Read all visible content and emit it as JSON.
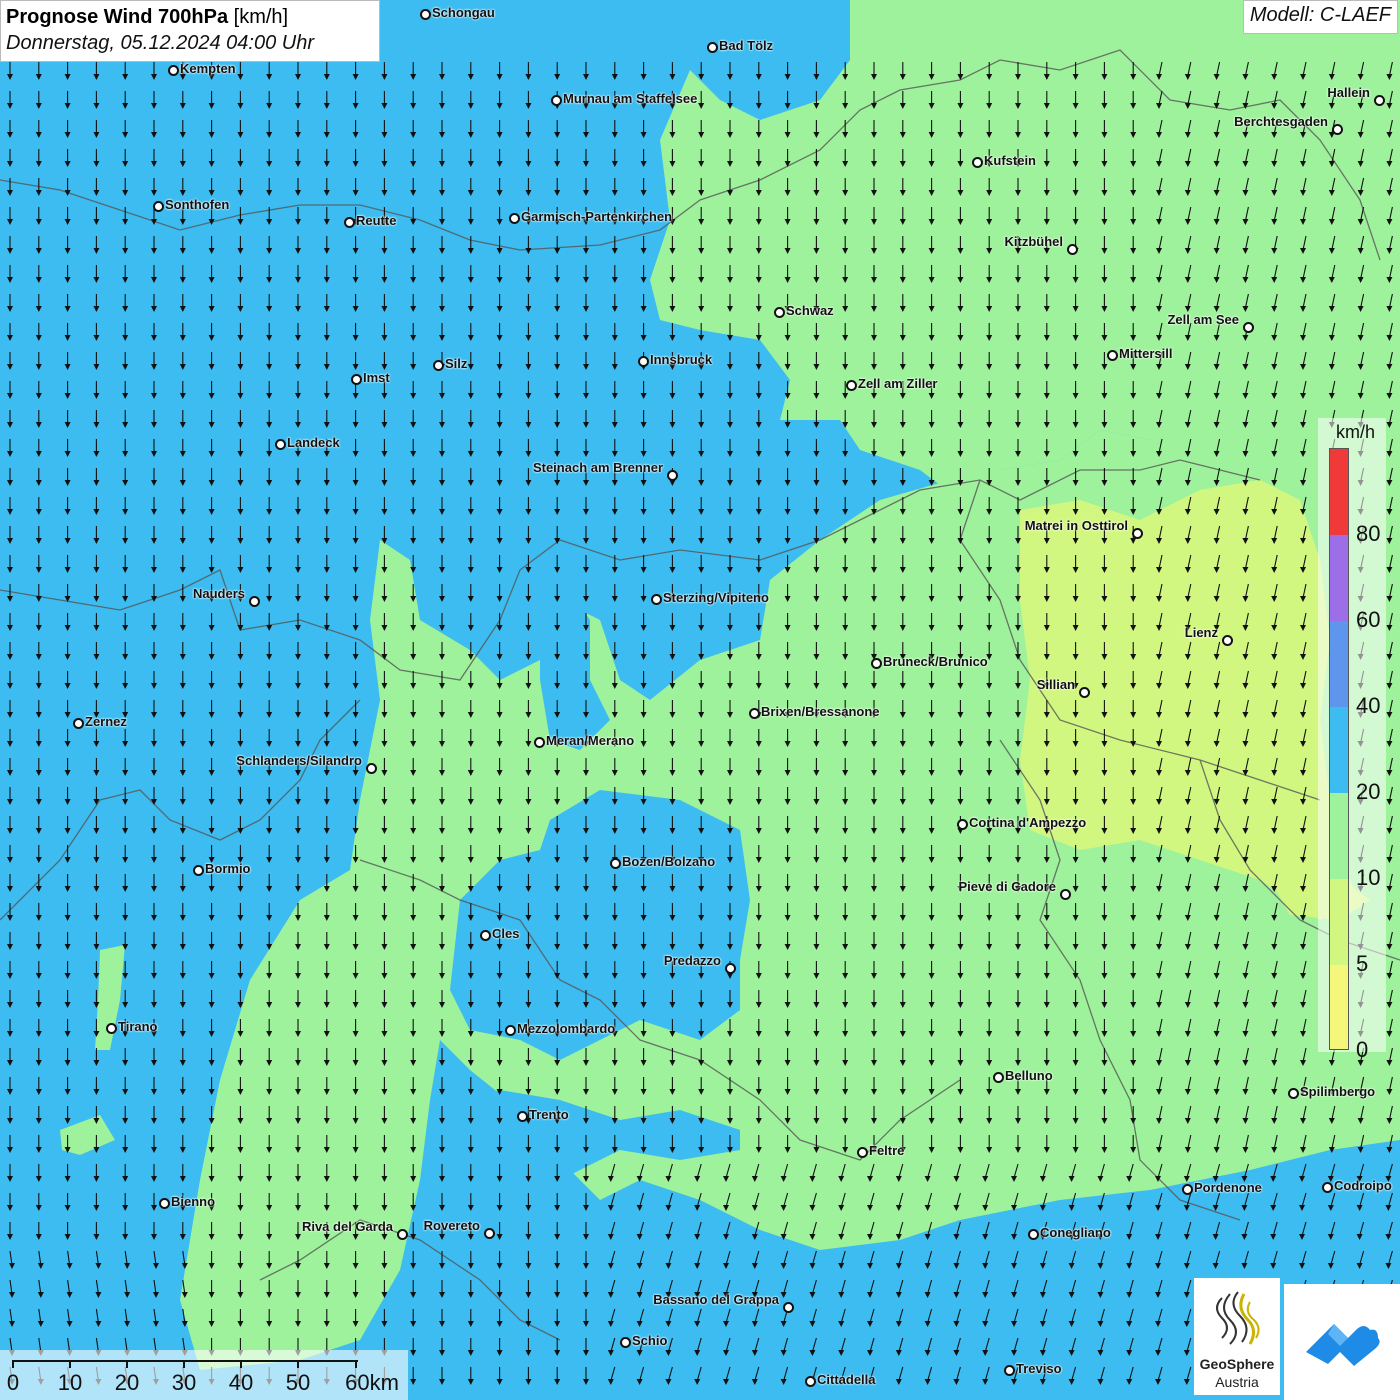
{
  "title": {
    "main": "Prognose Wind 700hPa",
    "unit": "[km/h]",
    "subtitle": "Donnerstag, 05.12.2024 04:00 Uhr"
  },
  "model_label": "Modell: C-LAEF",
  "colors": {
    "wind_0_5": "#f5f77a",
    "wind_5_10": "#d2f781",
    "wind_10_20": "#9ef29b",
    "wind_20_40": "#3cbcf0",
    "wind_40_60": "#5e96ee",
    "wind_60_80": "#9c6ee8",
    "wind_80_plus": "#f03a3a",
    "arrow": "#111111",
    "border": "#555555"
  },
  "legend": {
    "unit": "km/h",
    "ticks": [
      "80",
      "60",
      "40",
      "20",
      "10",
      "5",
      "0"
    ]
  },
  "wind_field": {
    "predominant_direction": "from north (arrows pointing south)",
    "arrow_icon": "wind-arrow-icon"
  },
  "cities": [
    {
      "name": "Schongau"
    },
    {
      "name": "Kempten"
    },
    {
      "name": "Bad Tölz"
    },
    {
      "name": "Murnau am Staffelsee"
    },
    {
      "name": "Hallein"
    },
    {
      "name": "Berchtesgaden"
    },
    {
      "name": "Kufstein"
    },
    {
      "name": "Sonthofen"
    },
    {
      "name": "Reutte"
    },
    {
      "name": "Garmisch-Partenkirchen"
    },
    {
      "name": "Kitzbühel"
    },
    {
      "name": "Schwaz"
    },
    {
      "name": "Zell am See"
    },
    {
      "name": "Mittersill"
    },
    {
      "name": "Innsbruck"
    },
    {
      "name": "Silz"
    },
    {
      "name": "Imst"
    },
    {
      "name": "Zell am Ziller"
    },
    {
      "name": "Landeck"
    },
    {
      "name": "Steinach am Brenner"
    },
    {
      "name": "Matrei in Osttirol"
    },
    {
      "name": "Nauders"
    },
    {
      "name": "Sterzing/Vipiteno"
    },
    {
      "name": "Lienz"
    },
    {
      "name": "Bruneck/Brunico"
    },
    {
      "name": "Sillian"
    },
    {
      "name": "Brixen/Bressanone"
    },
    {
      "name": "Zernez"
    },
    {
      "name": "Meran/Merano"
    },
    {
      "name": "Schlanders/Silandro"
    },
    {
      "name": "Cortina d'Ampezzo"
    },
    {
      "name": "Bozen/Bolzano"
    },
    {
      "name": "Bormio"
    },
    {
      "name": "Pieve di Cadore"
    },
    {
      "name": "Cles"
    },
    {
      "name": "Predazzo"
    },
    {
      "name": "Tirano"
    },
    {
      "name": "Mezzolombardo"
    },
    {
      "name": "Belluno"
    },
    {
      "name": "Spilimbergo"
    },
    {
      "name": "Trento"
    },
    {
      "name": "Feltre"
    },
    {
      "name": "Pordenone"
    },
    {
      "name": "Codroipo"
    },
    {
      "name": "Bienno"
    },
    {
      "name": "Riva del Garda"
    },
    {
      "name": "Rovereto"
    },
    {
      "name": "Conegliano"
    },
    {
      "name": "Bassano del Grappa"
    },
    {
      "name": "Schio"
    },
    {
      "name": "Treviso"
    },
    {
      "name": "Cittadella"
    }
  ],
  "scale": {
    "labels": [
      "0",
      "10",
      "20",
      "30",
      "40",
      "50",
      "60km"
    ]
  },
  "logos": {
    "geosphere_line1": "GeoSphere",
    "geosphere_line2": "Austria"
  }
}
